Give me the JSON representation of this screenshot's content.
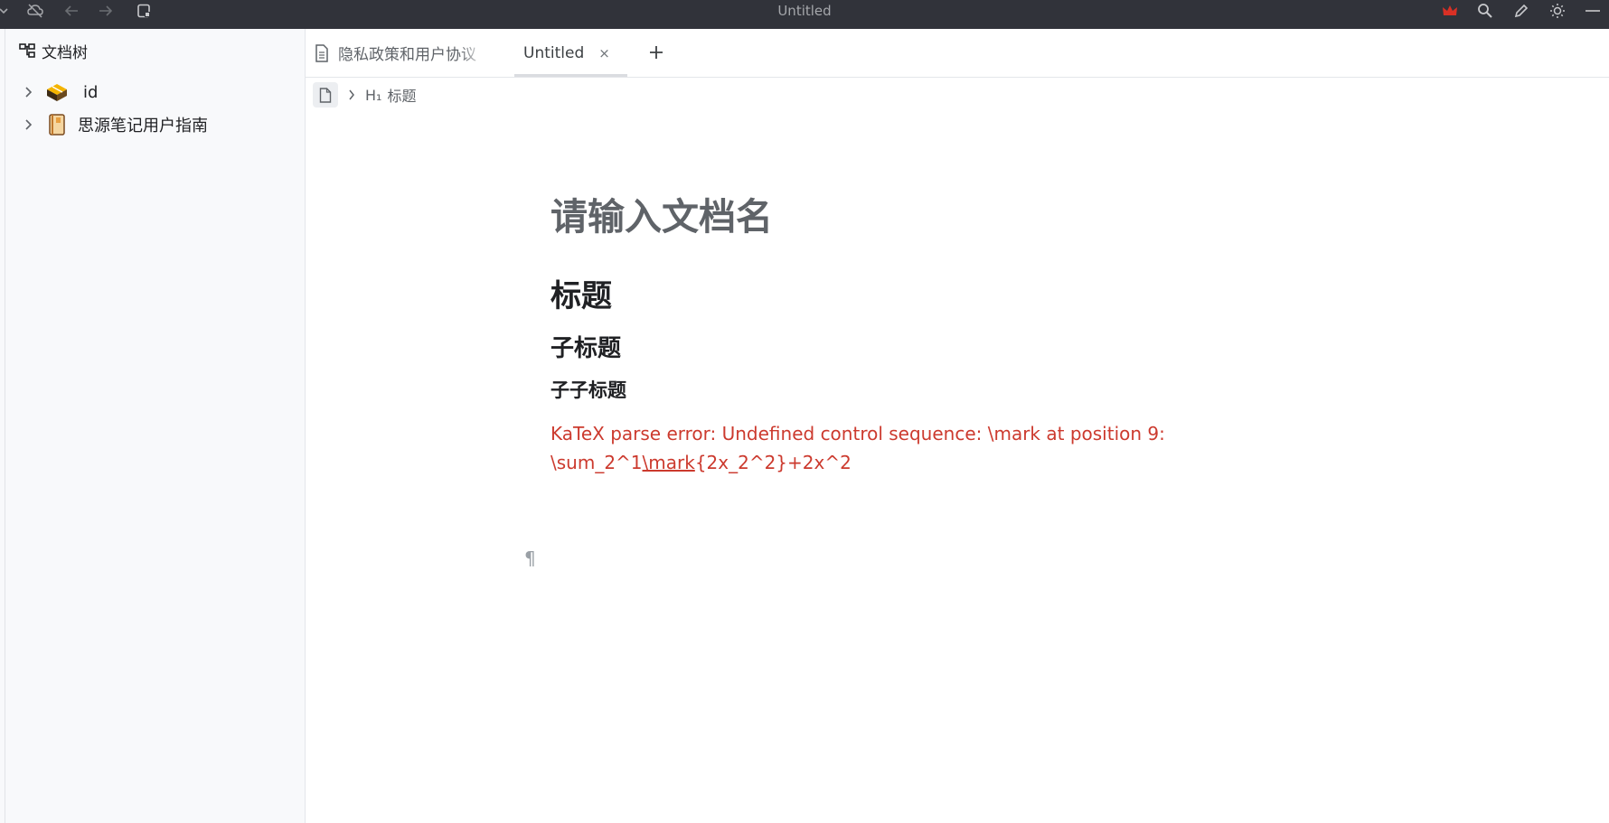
{
  "window": {
    "title": "Untitled"
  },
  "sidebar": {
    "header": "文档树",
    "items": [
      {
        "label": "id",
        "icon": "notebook-box-icon"
      },
      {
        "label": "思源笔记用户指南",
        "icon": "notebook-book-icon"
      }
    ]
  },
  "tabs": [
    {
      "label": "隐私政策和用户协议",
      "active": false
    },
    {
      "label": "Untitled",
      "active": true,
      "close": "×"
    }
  ],
  "breadcrumb": {
    "heading_level": "H₁",
    "heading": "标题"
  },
  "editor": {
    "doc_title_placeholder": "请输入文档名",
    "h1": "标题",
    "h2": "子标题",
    "h3": "子子标题",
    "katex_error_line1": "KaTeX parse error: Undefined control sequence: \\mark at position 9:",
    "katex_error_before": "\\sum_2^1",
    "katex_error_highlight": "\\mark",
    "katex_error_after": "{2x_2^2}+2x^2",
    "paragraph_mark": "¶"
  },
  "colors": {
    "topbar": "#31333a",
    "error_text": "#cc3a2e",
    "sidebar_bg": "#f8f9fb",
    "crown": "#d93025"
  }
}
